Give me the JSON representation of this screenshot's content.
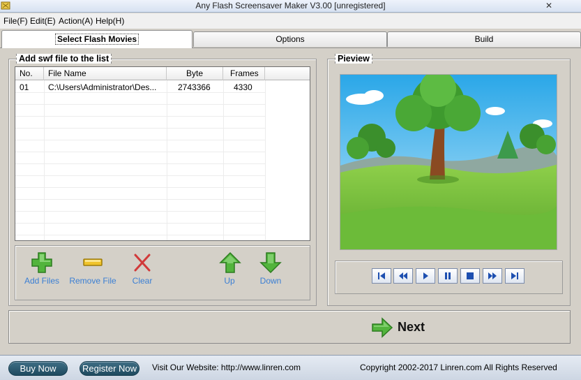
{
  "window": {
    "title": "Any Flash Screensaver Maker V3.00 [unregistered]"
  },
  "menu": [
    {
      "label": "File(F)"
    },
    {
      "label": "Edit(E)"
    },
    {
      "label": "Action(A)"
    },
    {
      "label": "Help(H)"
    }
  ],
  "tabs": [
    {
      "label": "Select Flash Movies",
      "active": true
    },
    {
      "label": "Options",
      "active": false
    },
    {
      "label": "Build",
      "active": false
    }
  ],
  "list_group": {
    "title": "Add swf file to the list",
    "columns": [
      "No.",
      "File Name",
      "Byte",
      "Frames"
    ],
    "rows": [
      {
        "no": "01",
        "file": "C:\\Users\\Administrator\\Des...",
        "byte": "2743366",
        "frames": "4330"
      }
    ]
  },
  "toolbar": {
    "add_files": "Add Files",
    "remove_file": "Remove File",
    "clear": "Clear",
    "up": "Up",
    "down": "Down"
  },
  "preview_group": {
    "title": "Pieview"
  },
  "next_button": "Next",
  "status": {
    "buy_now": "Buy Now",
    "register_now": "Register Now",
    "website": "Visit Our Website: http://www.linren.com",
    "copyright": "Copyright 2002-2017 Linren.com All Rights Reserved"
  },
  "colors": {
    "link_blue": "#3b7fd4",
    "pill_button": "#2a5a70",
    "panel": "#d4d0c8"
  }
}
